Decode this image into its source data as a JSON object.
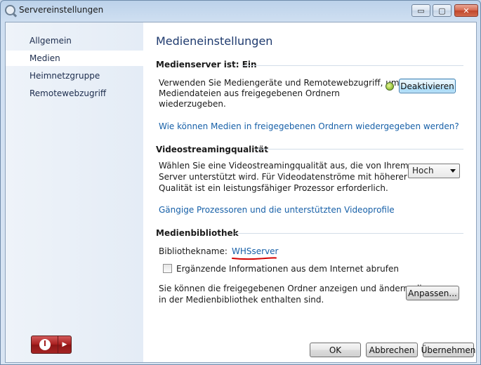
{
  "window": {
    "title": "Servereinstellungen",
    "caption_buttons": {
      "minimize": "▭",
      "maximize": "▢",
      "close": "✕"
    }
  },
  "sidebar": {
    "items": [
      {
        "label": "Allgemein",
        "active": false
      },
      {
        "label": "Medien",
        "active": true
      },
      {
        "label": "Heimnetzgruppe",
        "active": false
      },
      {
        "label": "Remotewebzugriff",
        "active": false
      }
    ],
    "power_button": {
      "icon": "power-icon",
      "arrow": "▶"
    }
  },
  "main": {
    "title": "Medieneinstellungen",
    "media_server": {
      "heading": "Medienserver ist: Ein",
      "description_lines": [
        "Verwenden Sie Mediengeräte und Remotewebzugriff, um",
        "Mediendateien aus freigegebenen Ordnern",
        "wiederzugeben."
      ],
      "status_icon": "status-green-icon",
      "deactivate_button": "Deaktivieren",
      "help_link": "Wie können Medien in freigegebenen Ordnern wiedergegeben werden?"
    },
    "video_quality": {
      "heading": "Videostreamingqualität",
      "description_lines": [
        "Wählen Sie eine Videostreamingqualität aus, die von Ihrem",
        "Server unterstützt wird. Für Videodatenströme mit höherer",
        "Qualität ist ein leistungsfähiger Prozessor erforderlich."
      ],
      "select_value": "Hoch",
      "link": "Gängige Prozessoren und die unterstützten Videoprofile"
    },
    "media_library": {
      "heading": "Medienbibliothek",
      "name_label": "Bibliothekname:",
      "name_value": "WHSserver",
      "checkbox_label": "Ergänzende Informationen aus dem Internet abrufen",
      "checkbox_checked": false,
      "description_lines": [
        "Sie können die freigegebenen Ordner anzeigen und ändern, die",
        "in der Medienbibliothek enthalten sind."
      ],
      "customize_button": "Anpassen..."
    },
    "footer": {
      "ok": "OK",
      "cancel": "Abbrechen",
      "apply": "Übernehmen"
    }
  },
  "colors": {
    "link": "#1760a8",
    "title": "#1e3a6e",
    "annotation_red": "#d40000"
  }
}
